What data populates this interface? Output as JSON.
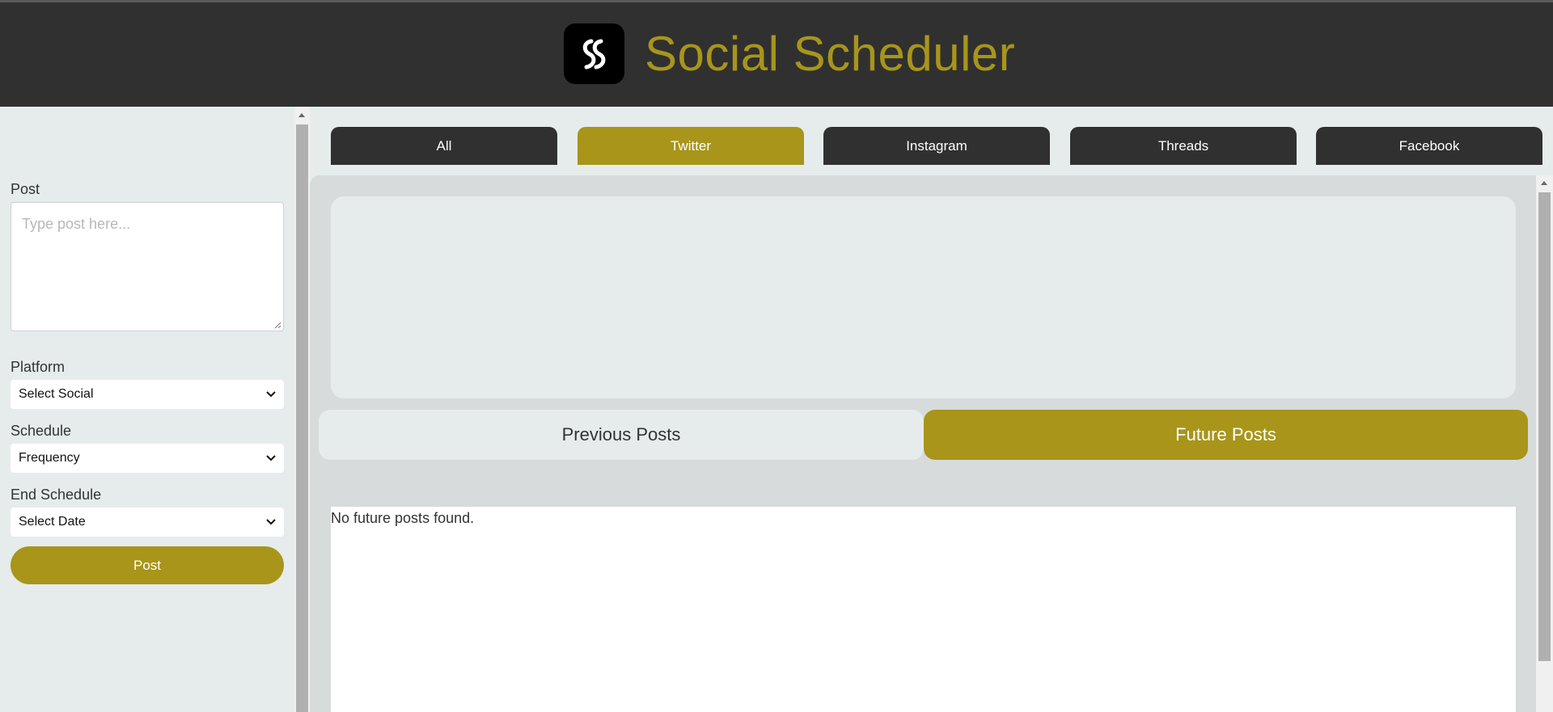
{
  "app": {
    "title": "Social Scheduler",
    "logo_icon": "ss-logo-icon",
    "brand_color": "#a8951a",
    "header_color": "#303030"
  },
  "sidebar": {
    "post_label": "Post",
    "post_placeholder": "Type post here...",
    "post_value": "",
    "platform_label": "Platform",
    "platform_selected": "Select Social",
    "schedule_label": "Schedule",
    "schedule_selected": "Frequency",
    "end_schedule_label": "End Schedule",
    "end_schedule_selected": "Select Date",
    "post_button": "Post"
  },
  "tabs": [
    {
      "label": "All",
      "active": false
    },
    {
      "label": "Twitter",
      "active": true
    },
    {
      "label": "Instagram",
      "active": false
    },
    {
      "label": "Threads",
      "active": false
    },
    {
      "label": "Facebook",
      "active": false
    }
  ],
  "posts_toggle": {
    "previous_label": "Previous Posts",
    "future_label": "Future Posts",
    "active": "future"
  },
  "posts_list": {
    "empty_message": "No future posts found."
  }
}
